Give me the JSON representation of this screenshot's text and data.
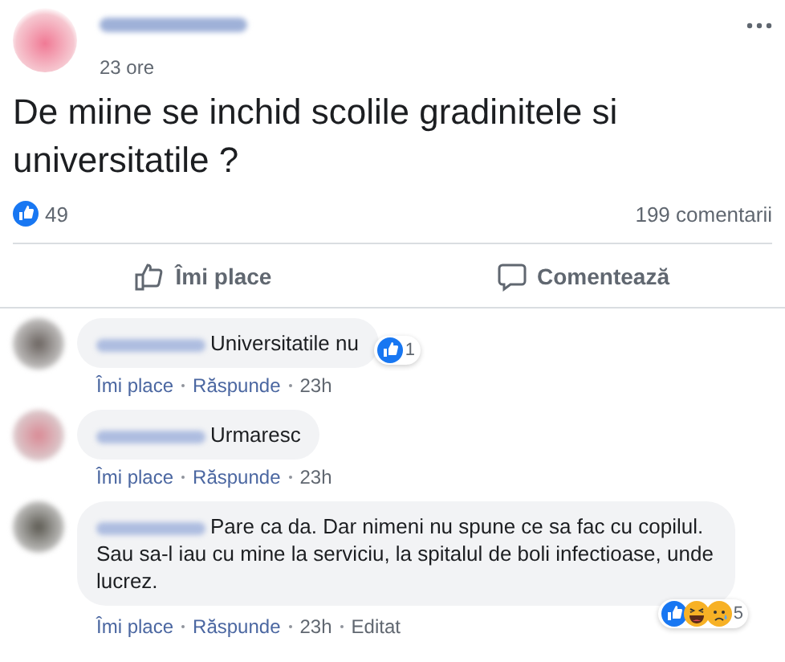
{
  "post": {
    "time": "23 ore",
    "text": "De miine se inchid scolile gradinitele si universitatile ?",
    "like_count": "49",
    "comment_count": "199 comentarii"
  },
  "actions": [
    {
      "kind": "like",
      "label": "Îmi place"
    },
    {
      "kind": "comment",
      "label": "Comentează"
    }
  ],
  "comments": [
    {
      "text": "Universitatile nu",
      "reactions": [
        {
          "kind": "like"
        }
      ],
      "reaction_count": "1",
      "links": [
        "Îmi place",
        "Răspunde",
        "23h"
      ]
    },
    {
      "text": "Urmaresc",
      "links": [
        "Îmi place",
        "Răspunde",
        "23h"
      ]
    },
    {
      "text": "Pare ca da. Dar nimeni nu spune ce sa fac cu copilul. Sau sa-l iau cu mine la serviciu, la spitalul de boli infectioase, unde lucrez.",
      "reactions": [
        {
          "kind": "like"
        },
        {
          "kind": "haha"
        },
        {
          "kind": "sad"
        }
      ],
      "reaction_count": "5",
      "links": [
        "Îmi place",
        "Răspunde",
        "23h",
        "Editat"
      ]
    }
  ]
}
